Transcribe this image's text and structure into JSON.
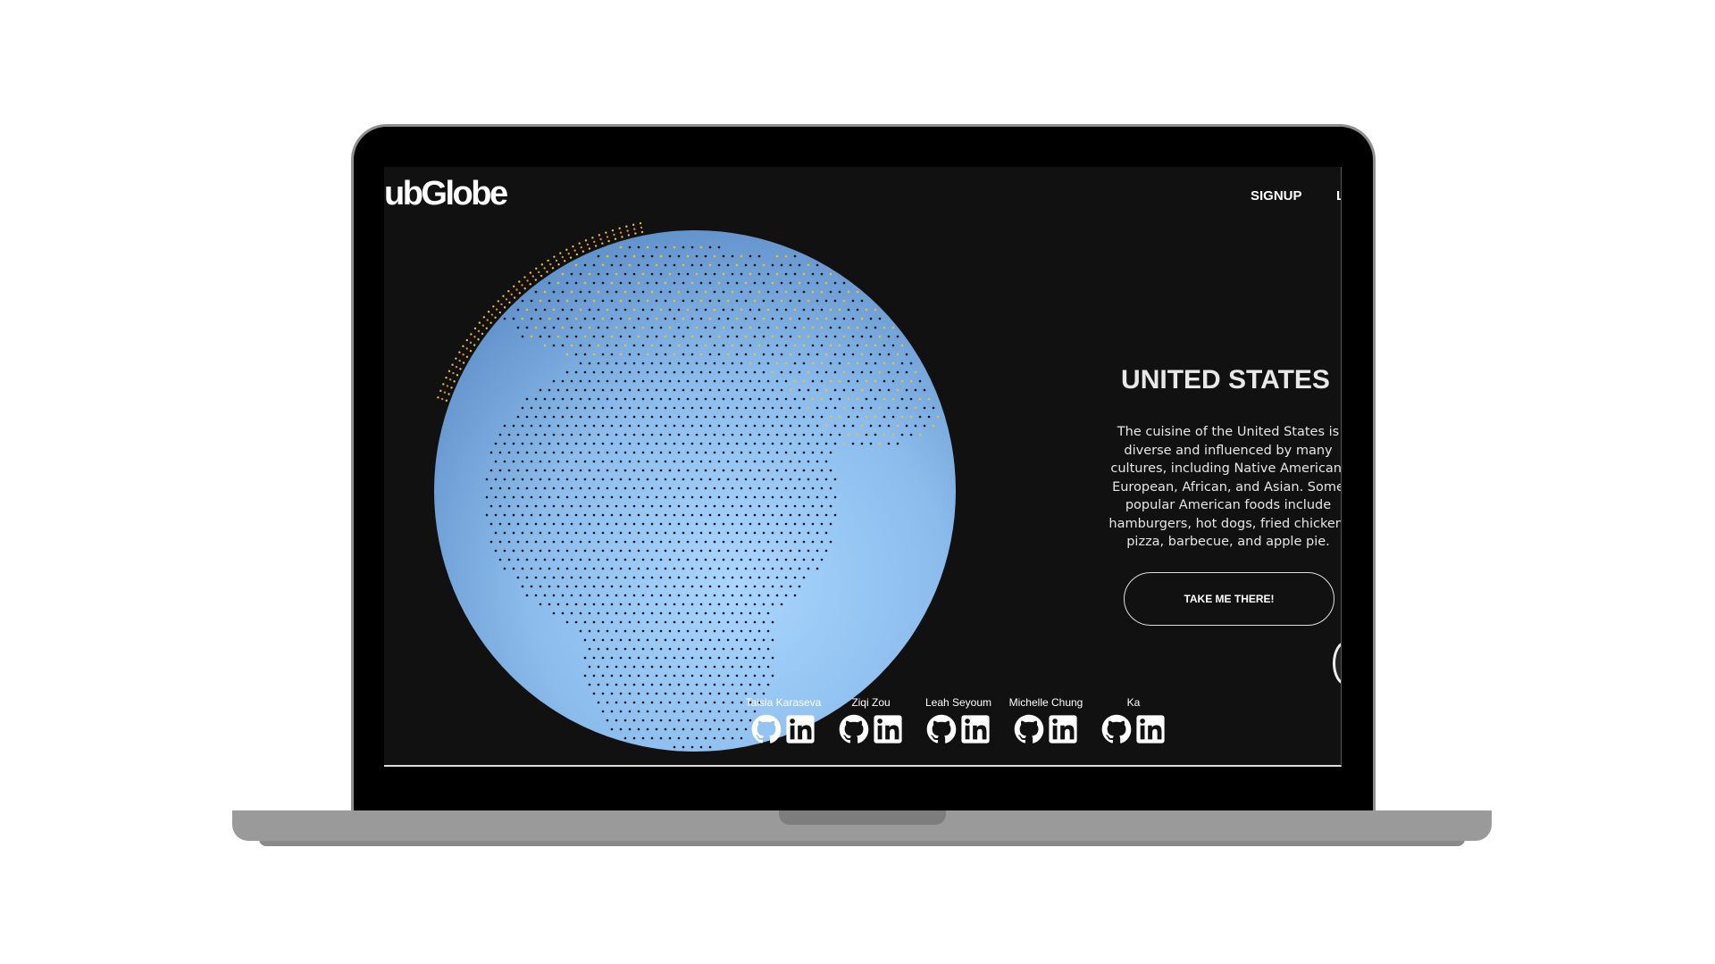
{
  "brand": {
    "logo_text": "ubGlobe"
  },
  "nav": {
    "signup_label": "SIGNUP",
    "next_label": "L"
  },
  "country": {
    "title": "UNITED STATES",
    "description": "The cuisine of the United States is diverse and influenced by many cultures, including Native American, European, African, and Asian. Some popular American foods include hamburgers, hot dogs, fried chicken, pizza, barbecue, and apple pie.",
    "cta_label": "TAKE ME THERE!"
  },
  "team": [
    {
      "name": "Taisia Karaseva"
    },
    {
      "name": "Ziqi Zou"
    },
    {
      "name": "Leah Seyoum"
    },
    {
      "name": "Michelle Chung"
    },
    {
      "name": "Ka"
    }
  ],
  "icons": {
    "github": "github-icon",
    "linkedin": "linkedin-icon"
  },
  "colors": {
    "screen_bg": "#111111",
    "globe_light": "#a6d4ff",
    "globe_dark": "#5d8ec9",
    "dot_dark": "#111111",
    "dot_gold": "#e8c03a",
    "dot_orange": "#e8892a"
  }
}
